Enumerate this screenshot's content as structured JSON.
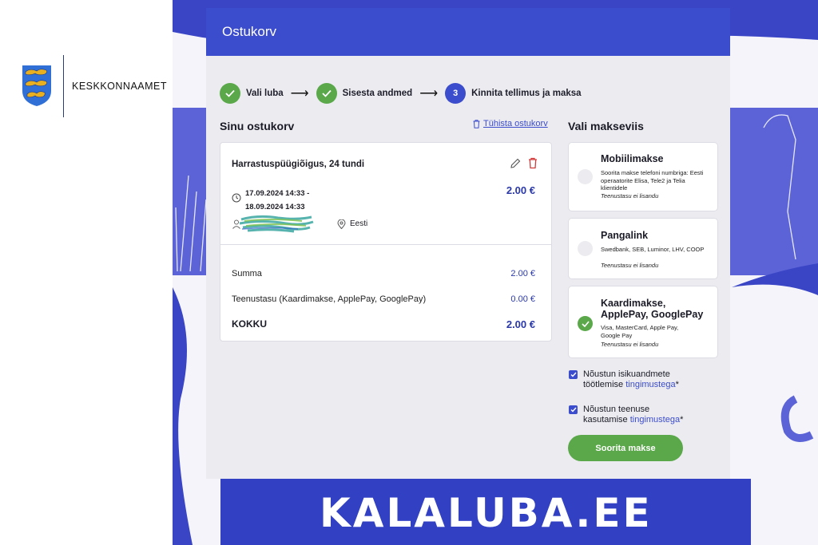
{
  "brand": {
    "name": "Keskkonnaamet",
    "crest_icon": "three-lions-crest-icon"
  },
  "card": {
    "title": "Ostukorv"
  },
  "steps": [
    {
      "label": "Vali luba",
      "state": "done"
    },
    {
      "label": "Sisesta andmed",
      "state": "done"
    },
    {
      "number": "3",
      "label": "Kinnita tellimus ja maksa",
      "state": "active"
    }
  ],
  "cart": {
    "title": "Sinu ostukorv",
    "cancel_label": "Tühista ostukorv",
    "item": {
      "title": "Harrastuspüügiõigus, 24 tundi",
      "date_from": "17.09.2024 14:33 -",
      "date_to": "18.09.2024 14:33",
      "price": "2.00 €",
      "country": "Eesti"
    },
    "summary": [
      {
        "label": "Summa",
        "value": "2.00 €"
      },
      {
        "label": "Teenustasu (Kaardimakse, ApplePay, GooglePay)",
        "value": "0.00 €"
      }
    ],
    "total": {
      "label": "KOKKU",
      "value": "2.00 €"
    }
  },
  "payment": {
    "title": "Vali makseviis",
    "options": [
      {
        "title": "Mobiilimakse",
        "desc": "Soorita makse telefoni numbriga: Eesti operaatorite Elisa, Tele2 ja Telia klientidele",
        "note": "Teenustasu ei lisandu",
        "selected": false
      },
      {
        "title": "Pangalink",
        "desc": "Swedbank, SEB, Luminor, LHV, COOP",
        "note": "Teenustasu ei lisandu",
        "selected": false
      },
      {
        "title": "Kaardimakse, ApplePay, GooglePay",
        "desc": "Visa, MasterCard, Apple Pay, Google Pay",
        "note": "Teenustasu ei lisandu",
        "selected": true
      }
    ]
  },
  "consents": [
    {
      "text_1": "Nõustun isikuandmete",
      "text_2": "töötlemise ",
      "link": "tingimustega",
      "suffix": "*",
      "checked": true
    },
    {
      "text_1": "Nõustun teenuse",
      "text_2": "kasutamise ",
      "link": "tingimustega",
      "suffix": "*",
      "checked": true
    }
  ],
  "pay_button": "Soorita makse",
  "banner": {
    "text": "KALALUBA.EE"
  },
  "colors": {
    "primary": "#3b4ccc",
    "success": "#5aa84a",
    "banner": "#3240c4"
  }
}
